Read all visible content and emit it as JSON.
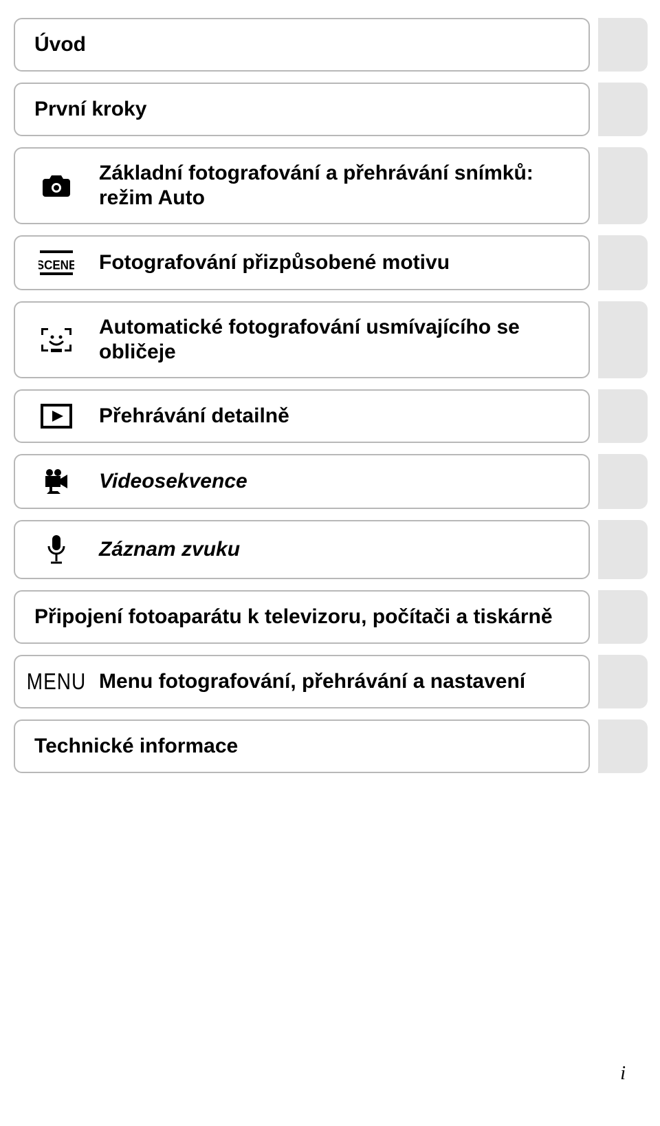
{
  "items": [
    {
      "label": "Úvod",
      "icon": null,
      "italic": false
    },
    {
      "label": "První kroky",
      "icon": null,
      "italic": false
    },
    {
      "label": "Základní fotografování a přehrávání snímků: režim Auto",
      "icon": "camera",
      "italic": false
    },
    {
      "label": "Fotografování přizpůsobené motivu",
      "icon": "scene",
      "italic": false
    },
    {
      "label": "Automatické fotografování usmívajícího se obličeje",
      "icon": "smile",
      "italic": false
    },
    {
      "label": "Přehrávání detailně",
      "icon": "play",
      "italic": false
    },
    {
      "label": "Videosekvence",
      "icon": "movie",
      "italic": true
    },
    {
      "label": "Záznam zvuku",
      "icon": "mic",
      "italic": true
    },
    {
      "label": "Připojení fotoaparátu k televizoru, počítači a tiskárně",
      "icon": null,
      "italic": false
    },
    {
      "label": "Menu fotografování, přehrávání a nastavení",
      "icon": "menu",
      "italic": false
    },
    {
      "label": "Technické informace",
      "icon": null,
      "italic": false
    }
  ],
  "icon_labels": {
    "camera": "camera-icon",
    "scene": "scene-icon",
    "smile": "smile-icon",
    "play": "play-icon",
    "movie": "movie-camera-icon",
    "mic": "microphone-icon",
    "menu": "menu-text-icon"
  },
  "menu_text": "MENU",
  "page_number": "i"
}
